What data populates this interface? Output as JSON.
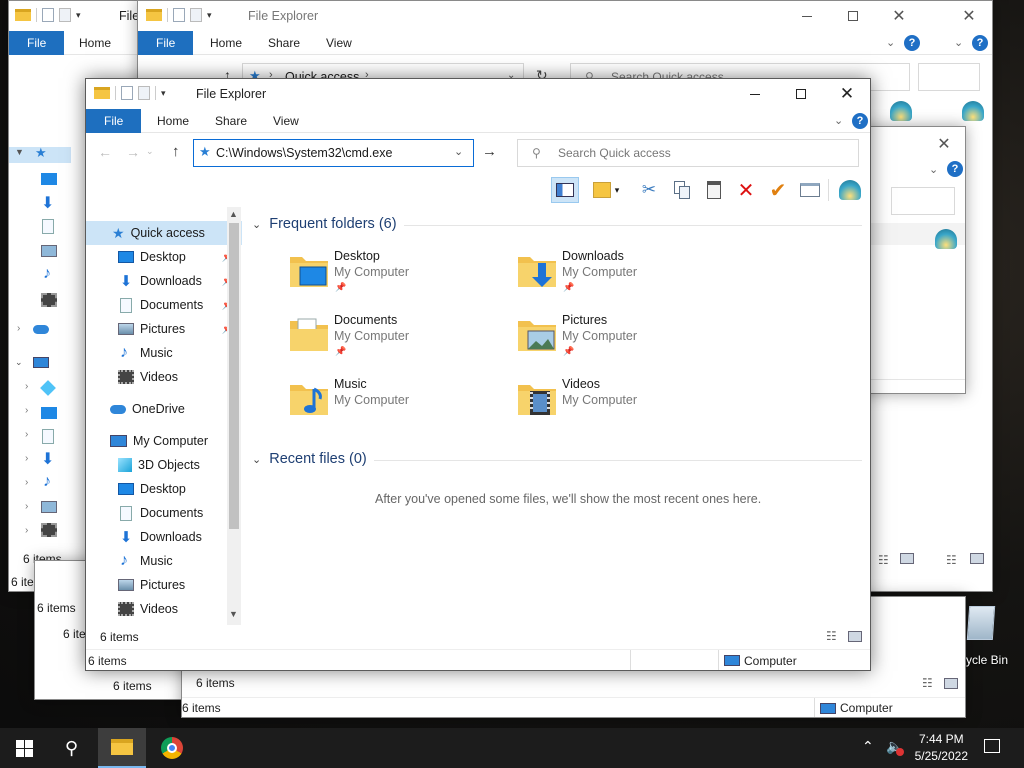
{
  "app_title": "File Explorer",
  "ribbon_tabs": {
    "file": "File",
    "home": "Home",
    "share": "Share",
    "view": "View"
  },
  "help_glyph": "?",
  "address": {
    "value": "C:\\Windows\\System32\\cmd.exe",
    "back_path_root": "Quick access",
    "search_placeholder": "Search Quick access"
  },
  "nav": {
    "quick_access": "Quick access",
    "pinned": [
      "Desktop",
      "Downloads",
      "Documents",
      "Pictures"
    ],
    "unpinned": [
      "Music",
      "Videos"
    ],
    "onedrive": "OneDrive",
    "my_computer": "My Computer",
    "computer_children": [
      "3D Objects",
      "Desktop",
      "Documents",
      "Downloads",
      "Music",
      "Pictures",
      "Videos"
    ]
  },
  "content": {
    "frequent_header": "Frequent folders (6)",
    "recent_header": "Recent files (0)",
    "recent_empty": "After you've opened some files, we'll show the most recent ones here.",
    "location_label": "My Computer",
    "folders": [
      {
        "name": "Desktop",
        "icon": "desktop-folder-icon",
        "pinned": true
      },
      {
        "name": "Downloads",
        "icon": "downloads-folder-icon",
        "pinned": true
      },
      {
        "name": "Documents",
        "icon": "documents-folder-icon",
        "pinned": true
      },
      {
        "name": "Pictures",
        "icon": "pictures-folder-icon",
        "pinned": true
      },
      {
        "name": "Music",
        "icon": "music-folder-icon",
        "pinned": false
      },
      {
        "name": "Videos",
        "icon": "videos-folder-icon",
        "pinned": false
      }
    ]
  },
  "status": {
    "items": "6 items",
    "computer": "Computer"
  },
  "desktop": {
    "recycle_bin_partial": "ycle Bin"
  },
  "taskbar": {
    "time": "7:44 PM",
    "date": "5/25/2022"
  },
  "colors": {
    "accent": "#1e6fbf",
    "taskbar": "#1c1c1c",
    "folder": "#f5c542",
    "delete": "#dd1111",
    "rename_check": "#e08010"
  }
}
